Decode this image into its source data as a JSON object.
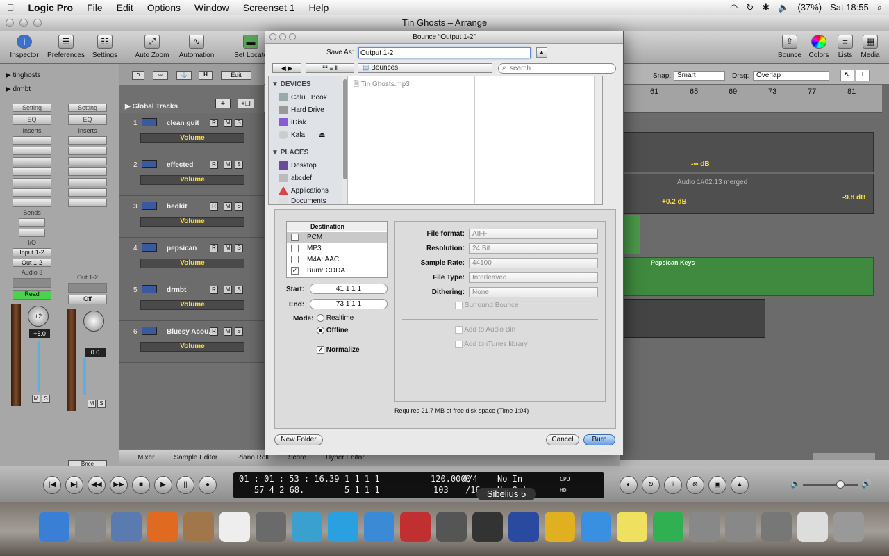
{
  "menubar": {
    "app": "Logic Pro",
    "items": [
      "File",
      "Edit",
      "Options",
      "Window",
      "Screenset 1",
      "Help"
    ],
    "battery": "(37%)",
    "clock": "Sat 18:55"
  },
  "window": {
    "title": "Tin Ghosts – Arrange"
  },
  "toolbar": {
    "left": [
      "Inspector",
      "Preferences",
      "Settings",
      "Auto Zoom",
      "Automation",
      "Set Locato"
    ],
    "right": [
      "Bounce",
      "Colors",
      "Lists",
      "Media"
    ]
  },
  "inspector": {
    "regions": [
      "tinghosts",
      "drmbt"
    ],
    "setting": "Setting",
    "eq": "EQ",
    "inserts": "Inserts",
    "sends": "Sends",
    "io": "I/O",
    "input": "Input 1-2",
    "output": "Out 1-2",
    "ch1": "Audio 3",
    "ch2": "Out 1-2",
    "read": "Read",
    "off": "Off",
    "pan": "+2",
    "gain": "+6.0",
    "gain2": "0.0",
    "m": "M",
    "s": "S",
    "bnce": "Bnce"
  },
  "tracks": {
    "header": "Global Tracks",
    "volume": "Volume",
    "items": [
      {
        "num": "1",
        "name": "clean guit"
      },
      {
        "num": "2",
        "name": "effected"
      },
      {
        "num": "3",
        "name": "bedkit"
      },
      {
        "num": "4",
        "name": "pepsican"
      },
      {
        "num": "5",
        "name": "drmbt"
      },
      {
        "num": "6",
        "name": "Bluesy Acou..."
      }
    ]
  },
  "arrange": {
    "snap_label": "Snap:",
    "snap": "Smart",
    "drag_label": "Drag:",
    "drag": "Overlap",
    "edit": "Edit",
    "ruler": [
      "61",
      "65",
      "69",
      "73",
      "77",
      "81"
    ],
    "region_merged": "Audio 1#02.13 merged",
    "db1": "-∞ dB",
    "db2": "+0.2 dB",
    "db3": "-9.8 dB",
    "pepsican_region": "Pepsican Keys"
  },
  "bottomtabs": [
    "Mixer",
    "Sample Editor",
    "Piano Roll",
    "Score",
    "Hyper Editor"
  ],
  "transport": {
    "smpte": "01 : 01 : 53 : 16.39",
    "smpte2": "57   4   2   68.",
    "bars1": "1   1   1     1",
    "bars2": "5   1   1     1",
    "tempo": "120.0000",
    "tempo2": "103",
    "sig": "4/4",
    "sig2": "/16",
    "in": "No In",
    "out": "No Out",
    "cpu": "CPU",
    "hd": "HD"
  },
  "tooltip": "Sibelius 5",
  "dock": [
    "finder",
    "system-prefs",
    "mail-stamp",
    "firefox",
    "address-book",
    "ical",
    "iphoto",
    "messenger",
    "skype",
    "itunes",
    "reason",
    "disk-utility",
    "logic",
    "sibelius",
    "iwork",
    "garageband",
    "stickies",
    "spotify",
    "automator",
    "photo-booth",
    "photo",
    "document",
    "trash"
  ],
  "dialog": {
    "title": "Bounce “Output 1-2”",
    "save_as_label": "Save As:",
    "save_as_value": "Output 1-2",
    "location": "Bounces",
    "search_placeholder": "search",
    "devices_header": "DEVICES",
    "devices": [
      "Calu...Book",
      "Hard Drive",
      "iDisk",
      "Kala"
    ],
    "places_header": "PLACES",
    "places": [
      "Desktop",
      "abcdef",
      "Applications",
      "Documents"
    ],
    "file": "Tin Ghosts.mp3",
    "dest_header": "Destination",
    "destinations": [
      {
        "name": "PCM",
        "checked": false
      },
      {
        "name": "MP3",
        "checked": false
      },
      {
        "name": "M4A: AAC",
        "checked": false
      },
      {
        "name": "Burn: CDDA",
        "checked": true
      }
    ],
    "start_label": "Start:",
    "start": "41   1   1     1",
    "end_label": "End:",
    "end": "73   1   1     1",
    "mode_label": "Mode:",
    "realtime": "Realtime",
    "offline": "Offline",
    "normalize": "Normalize",
    "formats": [
      {
        "label": "File format:",
        "value": "AIFF"
      },
      {
        "label": "Resolution:",
        "value": "24 Bit"
      },
      {
        "label": "Sample Rate:",
        "value": "44100"
      },
      {
        "label": "File Type:",
        "value": "Interleaved"
      },
      {
        "label": "Dithering:",
        "value": "None"
      }
    ],
    "surround": "Surround Bounce",
    "add_audio_bin": "Add to Audio Bin",
    "add_itunes": "Add to iTunes library",
    "disk_info": "Requires 21.7 MB of free disk space  (Time 1:04)",
    "new_folder": "New Folder",
    "cancel": "Cancel",
    "burn": "Burn"
  }
}
